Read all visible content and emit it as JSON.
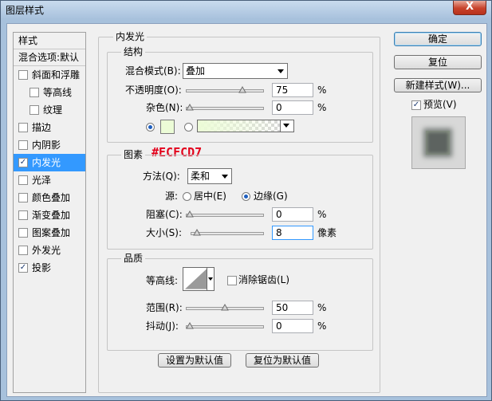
{
  "window": {
    "title": "图层样式",
    "close_glyph": "X"
  },
  "styles_panel": {
    "header": "样式",
    "blend_options": "混合选项:默认",
    "items": [
      {
        "label": "斜面和浮雕",
        "checked": false,
        "indent": false,
        "selected": false
      },
      {
        "label": "等高线",
        "checked": false,
        "indent": true,
        "selected": false
      },
      {
        "label": "纹理",
        "checked": false,
        "indent": true,
        "selected": false
      },
      {
        "label": "描边",
        "checked": false,
        "indent": false,
        "selected": false
      },
      {
        "label": "内阴影",
        "checked": false,
        "indent": false,
        "selected": false
      },
      {
        "label": "内发光",
        "checked": true,
        "indent": false,
        "selected": true
      },
      {
        "label": "光泽",
        "checked": false,
        "indent": false,
        "selected": false
      },
      {
        "label": "颜色叠加",
        "checked": false,
        "indent": false,
        "selected": false
      },
      {
        "label": "渐变叠加",
        "checked": false,
        "indent": false,
        "selected": false
      },
      {
        "label": "图案叠加",
        "checked": false,
        "indent": false,
        "selected": false
      },
      {
        "label": "外发光",
        "checked": false,
        "indent": false,
        "selected": false
      },
      {
        "label": "投影",
        "checked": true,
        "indent": false,
        "selected": false
      }
    ],
    "check_glyph": "✓"
  },
  "inner_glow": {
    "title": "内发光",
    "structure": {
      "title": "结构",
      "blend_mode_label": "混合模式(B):",
      "blend_mode_value": "叠加",
      "opacity_label": "不透明度(O):",
      "opacity_value": "75",
      "opacity_unit": "%",
      "opacity_fraction": 0.75,
      "noise_label": "杂色(N):",
      "noise_value": "0",
      "noise_unit": "%",
      "noise_fraction": 0.0,
      "glow_color": "#ecfcd7",
      "color_annotation": "#ECFCD7"
    },
    "elements": {
      "title": "图素",
      "technique_label": "方法(Q):",
      "technique_value": "柔和",
      "source_label": "源:",
      "source_center": "居中(E)",
      "source_edge": "边缘(G)",
      "source_selected": "edge",
      "choke_label": "阻塞(C):",
      "choke_value": "0",
      "choke_unit": "%",
      "choke_fraction": 0.0,
      "size_label": "大小(S):",
      "size_value": "8",
      "size_unit": "像素",
      "size_fraction": 0.032
    },
    "quality": {
      "title": "品质",
      "contour_label": "等高线:",
      "antialias_label": "消除锯齿(L)",
      "antialias_checked": false,
      "range_label": "范围(R):",
      "range_value": "50",
      "range_unit": "%",
      "range_fraction": 0.5,
      "jitter_label": "抖动(J):",
      "jitter_value": "0",
      "jitter_unit": "%",
      "jitter_fraction": 0.0
    },
    "make_default": "设置为默认值",
    "reset_default": "复位为默认值"
  },
  "buttons": {
    "ok": "确定",
    "reset": "复位",
    "new_style": "新建样式(W)...",
    "preview_label": "预览(V)",
    "preview_checked": true
  }
}
